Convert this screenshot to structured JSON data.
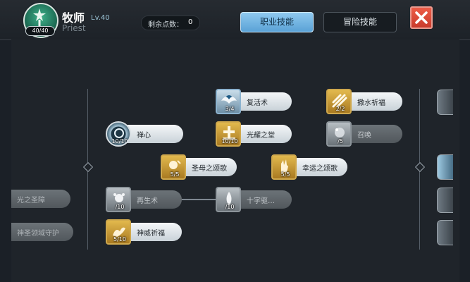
{
  "header": {
    "class_name": "牧师",
    "class_level": "Lv.40",
    "class_english": "Priest",
    "badge": "40/40",
    "points_label": "剩余点数：",
    "points_value": "0",
    "tabs": [
      {
        "label": "职业技能",
        "active": true
      },
      {
        "label": "冒险技能",
        "active": false
      }
    ]
  },
  "skills": {
    "fuhuo": {
      "name": "复活术",
      "level": "3/4",
      "icon": "angel-wings-icon"
    },
    "sashui": {
      "name": "撒水祈福",
      "level": "2/2",
      "icon": "water-ritual-icon"
    },
    "chanxin": {
      "name": "禅心",
      "level": "10/10",
      "icon": "meditation-ring-icon"
    },
    "guangyao": {
      "name": "光耀之堂",
      "level": "10/10",
      "icon": "holy-altar-icon"
    },
    "zhaohuan": {
      "name": "召唤",
      "level": "/5",
      "icon": "summon-icon"
    },
    "shengmu": {
      "name": "圣母之颂歌",
      "level": "5/5",
      "icon": "hymn-icon"
    },
    "xingyun": {
      "name": "幸运之颂歌",
      "level": "5/5",
      "icon": "lucky-hand-icon"
    },
    "zaisheng": {
      "name": "再生术",
      "level": "/10",
      "icon": "regeneration-icon"
    },
    "shizi": {
      "name": "十字驱…",
      "level": "/10",
      "icon": "cross-exorcism-icon"
    },
    "shenwei": {
      "name": "神威祈福",
      "level": "5/10",
      "icon": "divine-bless-icon"
    }
  },
  "edge_left": {
    "row1": "光之圣障",
    "row2": "神圣领域守护"
  },
  "colors": {
    "tab_active": "#6fb2e2",
    "close_button": "#e0483a",
    "emblem": "#2f8f6f",
    "gold_icon": "#d4a640"
  }
}
